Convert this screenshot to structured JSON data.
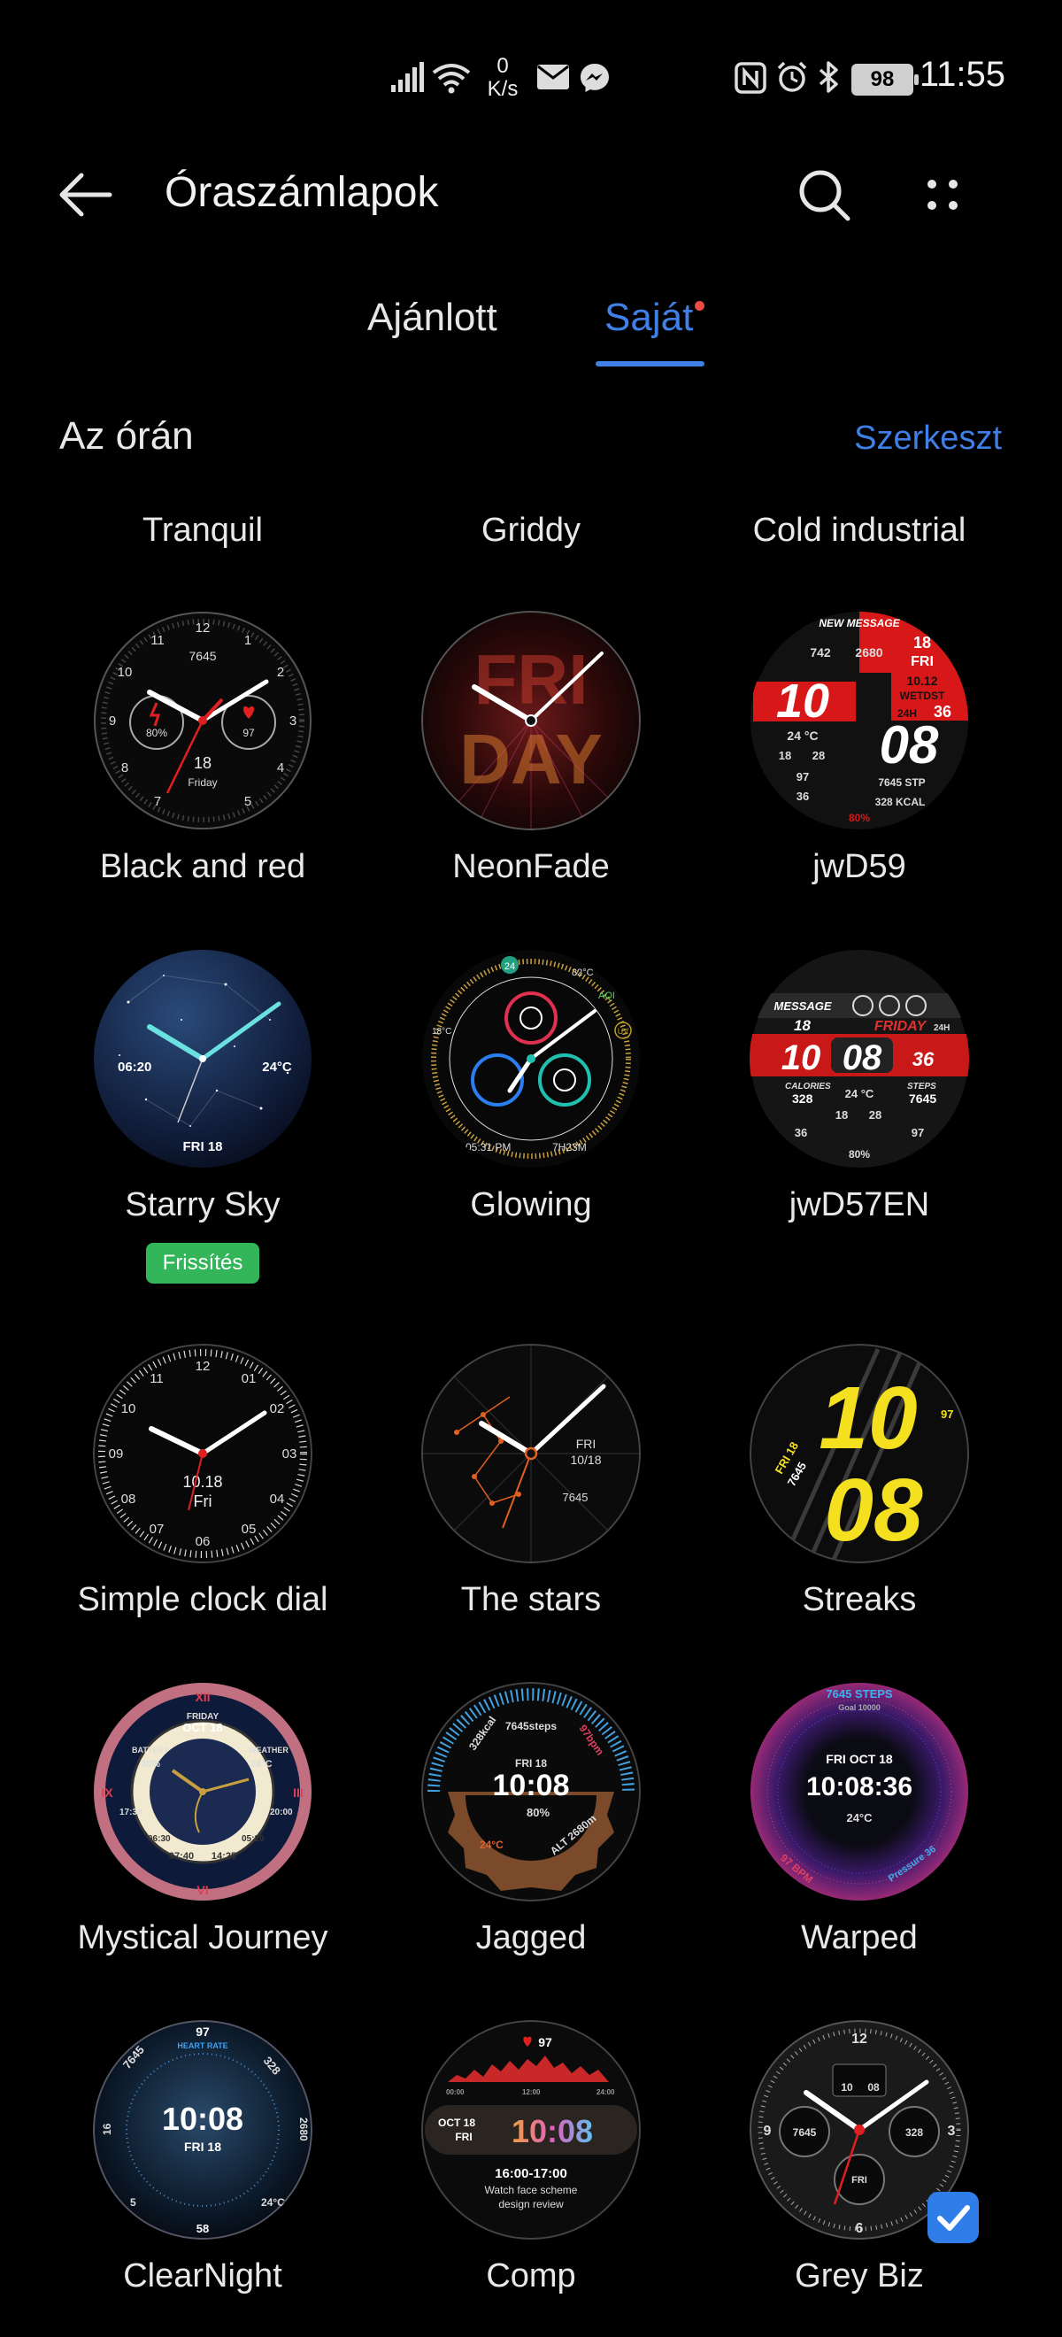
{
  "status": {
    "speed_value": "0",
    "speed_unit": "K/s",
    "battery": "98",
    "time": "11:55"
  },
  "appbar": {
    "title": "Óraszámlapok"
  },
  "tabs": [
    {
      "label": "Ajánlott",
      "active": false
    },
    {
      "label": "Saját",
      "active": true,
      "has_dot": true
    }
  ],
  "section": {
    "title": "Az órán",
    "edit_label": "Szerkeszt"
  },
  "top_names": [
    "Tranquil",
    "Griddy",
    "Cold industrial"
  ],
  "faces": [
    {
      "name": "Black and red"
    },
    {
      "name": "NeonFade"
    },
    {
      "name": "jwD59"
    },
    {
      "name": "Starry Sky",
      "update_label": "Frissítés"
    },
    {
      "name": "Glowing"
    },
    {
      "name": "jwD57EN"
    },
    {
      "name": "Simple clock dial"
    },
    {
      "name": "The stars"
    },
    {
      "name": "Streaks"
    },
    {
      "name": "Mystical Journey"
    },
    {
      "name": "Jagged"
    },
    {
      "name": "Warped"
    },
    {
      "name": "ClearNight"
    },
    {
      "name": "Comp"
    },
    {
      "name": "Grey Biz",
      "selected": true
    }
  ],
  "face_text": {
    "black_red": {
      "n12": "12",
      "n1": "1",
      "n2": "2",
      "n3": "3",
      "n4": "4",
      "n5": "5",
      "n7": "7",
      "n8": "8",
      "n9": "9",
      "n10": "10",
      "n11": "11",
      "steps": "7645",
      "batt": "80%",
      "heart": "97",
      "day": "18",
      "weekday": "Friday"
    },
    "neonfade": {
      "word1": "FRI",
      "word2": "DAY"
    },
    "jwd59": {
      "top": "NEW MESSAGE",
      "steps": "742",
      "alt": "2680",
      "day": "18",
      "wd": "FRI",
      "hour": "10",
      "date": "10.12",
      "wday": "WETDST",
      "p": "24H",
      "sec": "36",
      "minute": "08",
      "temp": "24 °C",
      "a": "18",
      "b": "28",
      "c": "97",
      "stp": "7645 STP",
      "hr": "36",
      "kcal": "328 KCAL",
      "batt": "80%"
    },
    "starry": {
      "time": "06:20",
      "temp": "24°C",
      "date": "FRI 18"
    },
    "glowing": {
      "b": "24",
      "t": "32°C",
      "aqi": "AQI",
      "uv": "UV",
      "l": "18°C",
      "bl": "05:31 PM",
      "br": "7H23M"
    },
    "jwd57": {
      "msg": "MESSAGE",
      "day": "18",
      "wd": "FRIDAY",
      "p": "24H",
      "hour": "10",
      "minute": "08",
      "sec": "36",
      "cal": "CALORIES",
      "cv": "328",
      "tmp": "24 °C",
      "steps": "STEPS",
      "sv": "7645",
      "a": "18",
      "b": "28",
      "hr": "36",
      "c": "97",
      "batt": "80%"
    },
    "simple": {
      "n12": "12",
      "n01": "01",
      "n02": "02",
      "n03": "03",
      "n04": "04",
      "n05": "05",
      "n06": "06",
      "n07": "07",
      "n08": "08",
      "n09": "09",
      "n10": "10",
      "n11": "11",
      "date": "10.18",
      "wd": "Fri"
    },
    "stars": {
      "wd": "FRI",
      "d": "10/18",
      "steps": "7645"
    },
    "streaks": {
      "h": "10",
      "m": "08",
      "d": "FRI 18",
      "s": "7645",
      "hr": "97"
    },
    "mystical": {
      "wd": "FRIDAY",
      "d": "OCT 18",
      "bat": "BATTERY",
      "bv": "80%",
      "w": "WEATHER",
      "wv": "24°C",
      "n12": "XII",
      "n3": "III",
      "n6": "VI",
      "n9": "IX",
      "a": "07:40",
      "b": "14:25",
      "c": "17:30",
      "e": "06:30",
      "f": "20:00",
      "g": "05:20"
    },
    "jagged": {
      "kcal": "328kcal",
      "steps": "7645steps",
      "bpm": "97bpm",
      "d": "FRI 18",
      "t": "10:08",
      "b": "80%",
      "tmp": "24°C",
      "alt": "ALT 2680m"
    },
    "warped": {
      "steps": "7645 STEPS",
      "goal": "Goal 10000",
      "d": "FRI OCT 18",
      "t": "10:08:36",
      "tmp": "24°C",
      "bpm": "97 BPM",
      "pr": "Pressure 36"
    },
    "clearnight": {
      "hr": "97",
      "hrl": "HEART RATE",
      "l": "7645",
      "r": "328",
      "t": "10:08",
      "d": "FRI 18",
      "ll": "16",
      "rr": "2680",
      "b": "58",
      "bl": "5",
      "br": "24°C"
    },
    "comp": {
      "hr": "97",
      "d1": "OCT 18",
      "d2": "FRI",
      "t": "10:08",
      "ev": "16:00-17:00",
      "e1": "Watch face scheme",
      "e2": "design review",
      "tl": "00:00",
      "tm": "12:00",
      "tr": "24:00"
    },
    "greybiz": {
      "n12": "12",
      "n3": "3",
      "n6": "6",
      "n9": "9",
      "a": "10",
      "b": "08",
      "steps": "7645",
      "kcal": "328",
      "day": "FRI"
    }
  },
  "colors": {
    "accent": "#3f7fe6",
    "background": "#000000",
    "badge_dot": "#ec4b42",
    "update_badge": "#33b55a"
  }
}
